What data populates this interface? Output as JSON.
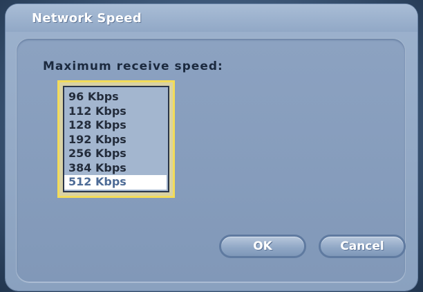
{
  "dialog": {
    "title": "Network Speed"
  },
  "field": {
    "label": "Maximum receive speed:"
  },
  "speed_list": {
    "items": [
      "96 Kbps",
      "112 Kbps",
      "128 Kbps",
      "192 Kbps",
      "256 Kbps",
      "384 Kbps",
      "512 Kbps"
    ],
    "selected": "512 Kbps"
  },
  "buttons": {
    "ok_label": "OK",
    "cancel_label": "Cancel"
  },
  "colors": {
    "focus_outline": "#f3dc58",
    "selection_bg": "#ffffff",
    "selection_text": "#4d6b96"
  }
}
